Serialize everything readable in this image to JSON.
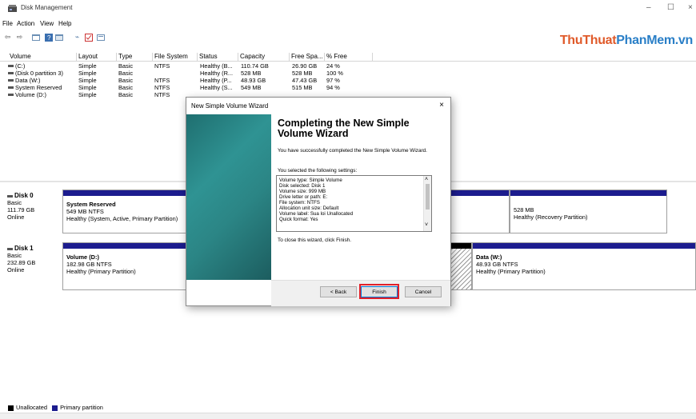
{
  "window": {
    "title": "Disk Management",
    "minimize": "–",
    "maximize": "☐",
    "close": "×"
  },
  "menu": [
    "File",
    "Action",
    "View",
    "Help"
  ],
  "watermark": {
    "part1": "ThuThuat",
    "part2": "PhanMem",
    "part3": ".vn",
    "color1": "#e05a2a",
    "color2": "#2a7fc7"
  },
  "volume_list": {
    "columns": [
      "Volume",
      "Layout",
      "Type",
      "File System",
      "Status",
      "Capacity",
      "Free Spa...",
      "% Free"
    ],
    "rows": [
      [
        "(C:)",
        "Simple",
        "Basic",
        "NTFS",
        "Healthy (B...",
        "110.74 GB",
        "26.90 GB",
        "24 %"
      ],
      [
        "(Disk 0 partition 3)",
        "Simple",
        "Basic",
        "",
        "Healthy (R...",
        "528 MB",
        "528 MB",
        "100 %"
      ],
      [
        "Data (W:)",
        "Simple",
        "Basic",
        "NTFS",
        "Healthy (P...",
        "48.93 GB",
        "47.43 GB",
        "97 %"
      ],
      [
        "System Reserved",
        "Simple",
        "Basic",
        "NTFS",
        "Healthy (S...",
        "549 MB",
        "515 MB",
        "94 %"
      ],
      [
        "Volume (D:)",
        "Simple",
        "Basic",
        "NTFS",
        "",
        "",
        "",
        ""
      ]
    ]
  },
  "disks": [
    {
      "name": "Disk 0",
      "type": "Basic",
      "size": "111.79 GB",
      "state": "Online",
      "partitions": [
        {
          "name": "System Reserved",
          "detail": "549 MB NTFS",
          "status": "Healthy (System, Active, Primary Partition)"
        },
        {
          "name": "",
          "detail": "528 MB",
          "status": "Healthy (Recovery Partition)"
        }
      ]
    },
    {
      "name": "Disk 1",
      "type": "Basic",
      "size": "232.89 GB",
      "state": "Online",
      "partitions": [
        {
          "name": "Volume (D:)",
          "detail": "182.98 GB NTFS",
          "status": "Healthy (Primary Partition)"
        },
        {
          "name": "Data (W:)",
          "detail": "48.93 GB NTFS",
          "status": "Healthy (Primary Partition)"
        }
      ]
    }
  ],
  "legend": {
    "unallocated": "Unallocated",
    "primary": "Primary partition",
    "unallocated_color": "#000000",
    "primary_color": "#1c1c8e"
  },
  "dialog": {
    "title": "New Simple Volume Wizard",
    "close": "×",
    "heading": "Completing the New Simple Volume Wizard",
    "success": "You have successfully completed the New Simple Volume Wizard.",
    "selected": "You selected the following settings:",
    "settings": [
      "Volume type: Simple Volume",
      "Disk selected: Disk 1",
      "Volume size: 999 MB",
      "Drive letter or path: E:",
      "File system: NTFS",
      "Allocation unit size: Default",
      "Volume label: Sua loi Unallocated",
      "Quick format: Yes"
    ],
    "close_hint": "To close this wizard, click Finish.",
    "back": "< Back",
    "finish": "Finish",
    "cancel": "Cancel",
    "highlight_color": "#e0202a"
  }
}
